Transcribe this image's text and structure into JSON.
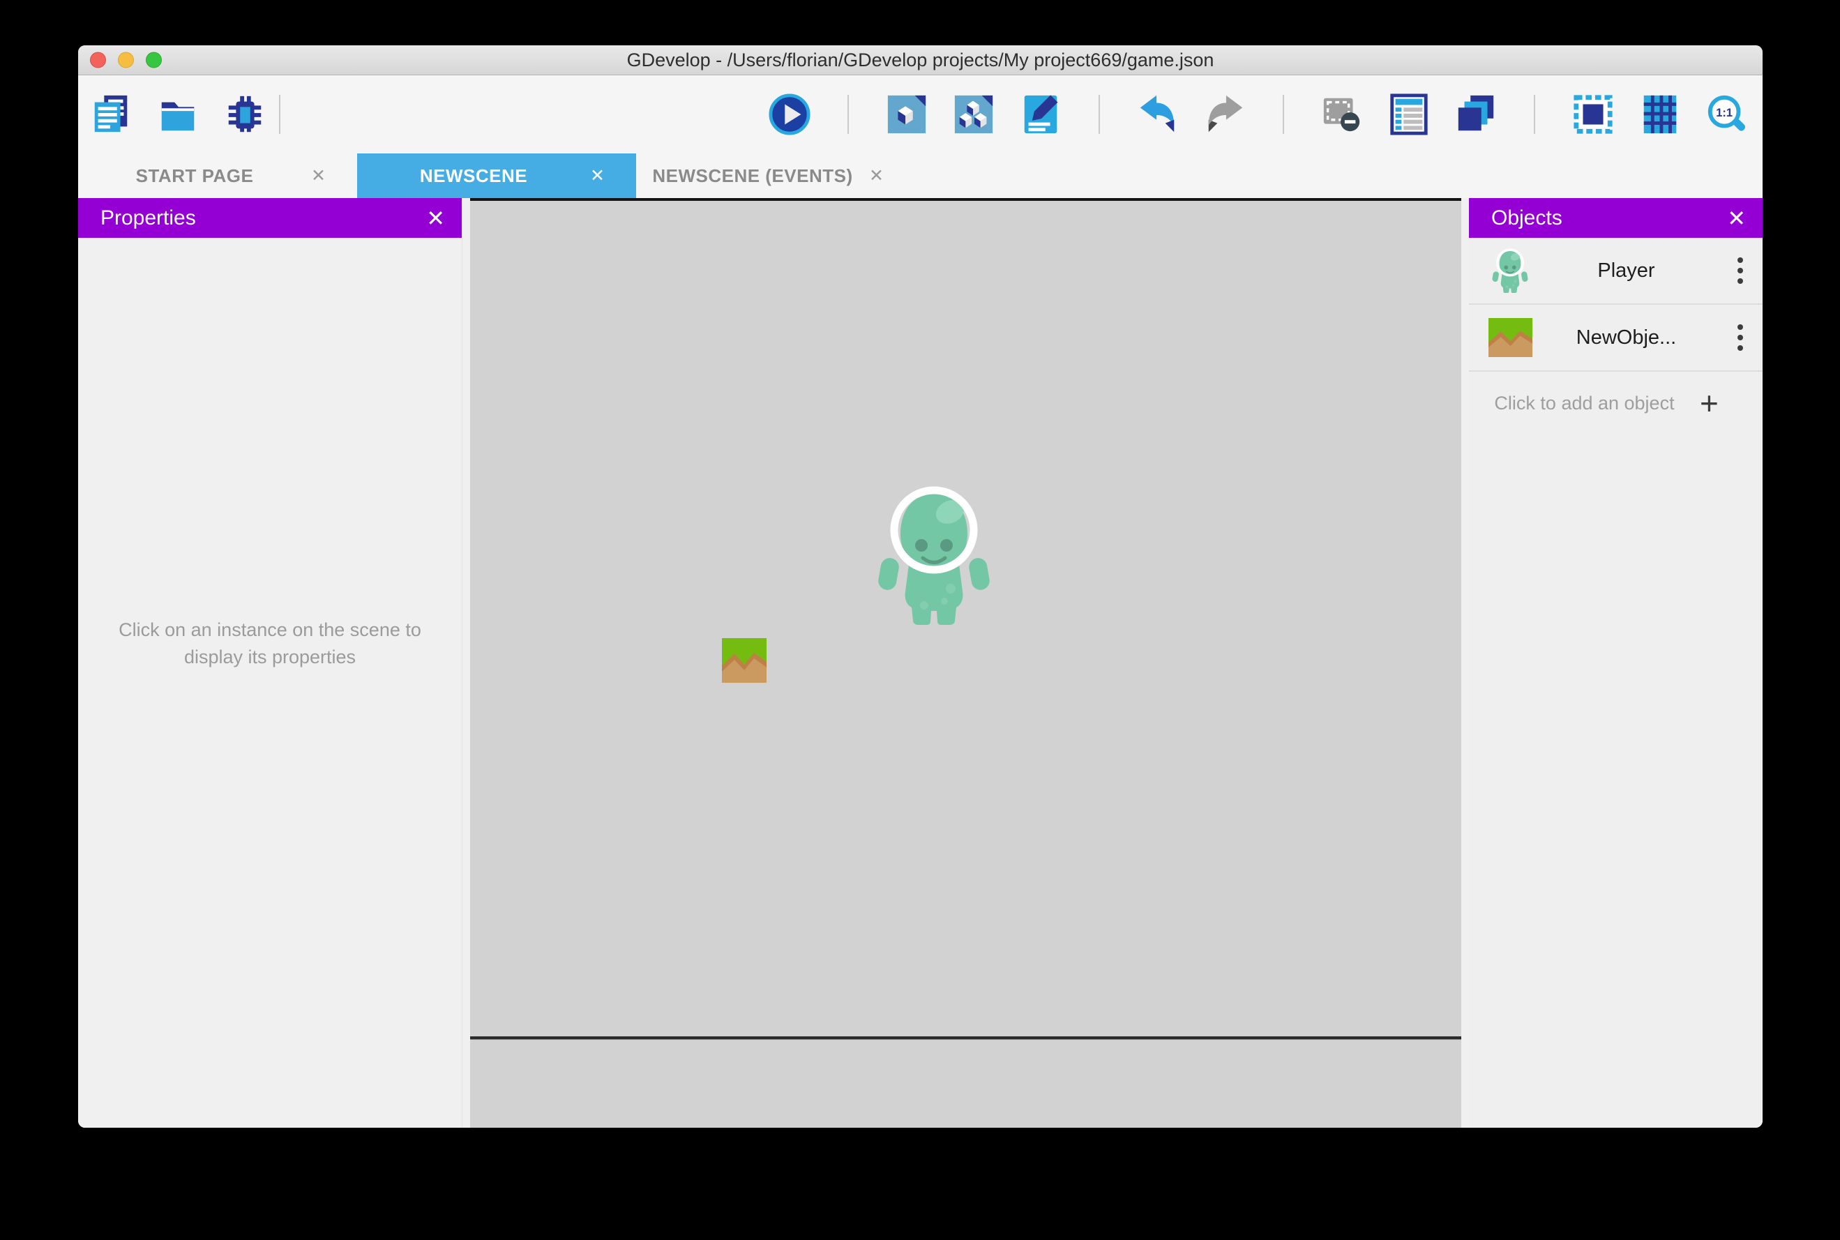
{
  "window": {
    "title": "GDevelop - /Users/florian/GDevelop projects/My project669/game.json"
  },
  "icons": {
    "close": "✕",
    "plus": "+"
  },
  "toolbar": {
    "left_icons": [
      "documents",
      "open-folder",
      "debugger"
    ],
    "right_icons": [
      "play",
      "objects-panel",
      "object-groups",
      "scene-properties",
      "undo",
      "redo",
      "filmstrip-remove",
      "instances-list",
      "layers",
      "window-mask",
      "grid",
      "zoom-1-1"
    ]
  },
  "tabs": [
    {
      "label": "START PAGE",
      "active": false
    },
    {
      "label": "NEWSCENE",
      "active": true
    },
    {
      "label": "NEWSCENE (EVENTS)",
      "active": false
    }
  ],
  "properties_panel": {
    "title": "Properties",
    "empty_message": "Click on an instance on the scene to display its properties"
  },
  "objects_panel": {
    "title": "Objects",
    "items": [
      {
        "name": "Player",
        "icon": "player-icon"
      },
      {
        "name": "NewObje...",
        "icon": "grass-tile-icon"
      }
    ],
    "add_label": "Click to add an object"
  },
  "colors": {
    "accent_purple": "#9400D3",
    "active_tab_blue": "#45ADE4",
    "toolbar_navy": "#283593",
    "toolbar_blue": "#29A8E0",
    "canvas_gray": "#D2D2D2",
    "player_teal": "#73C7A4",
    "tile_green": "#75BC10",
    "tile_brown": "#BD8145"
  }
}
